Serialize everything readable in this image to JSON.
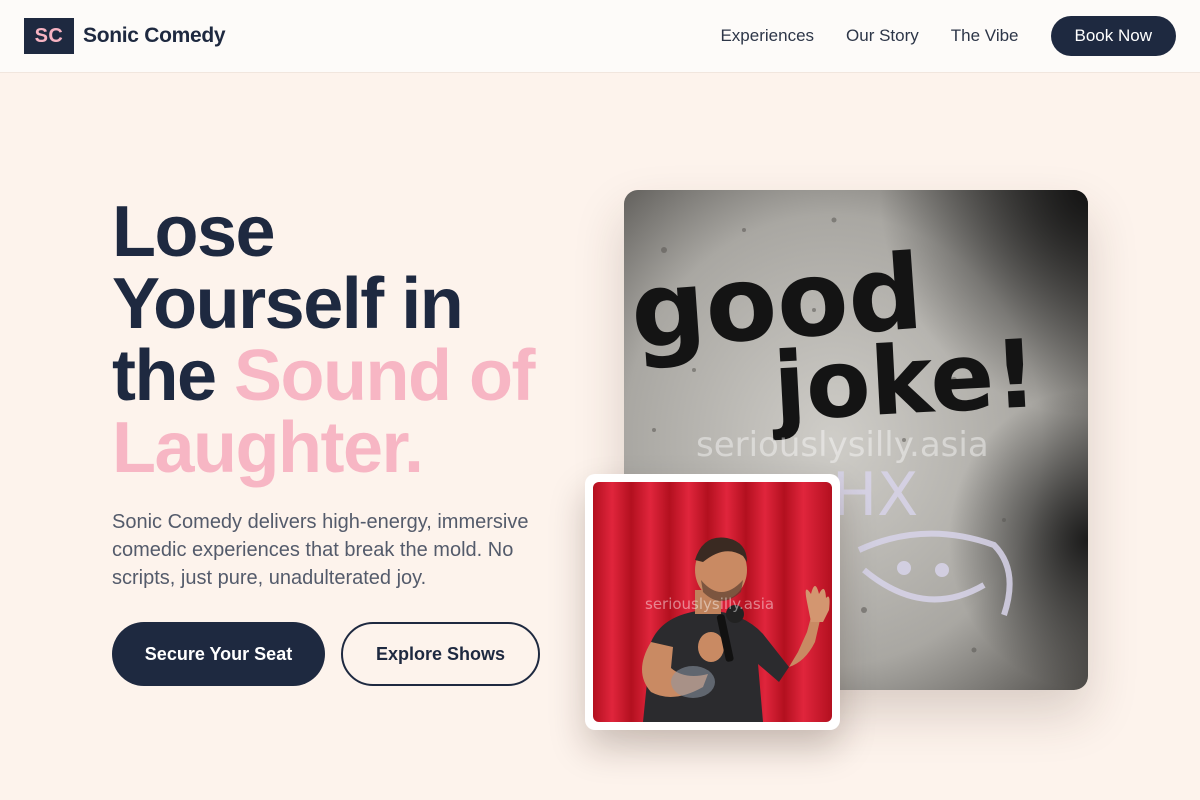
{
  "brand": {
    "logo_text": "SC",
    "name": "Sonic Comedy"
  },
  "nav": {
    "links": [
      "Experiences",
      "Our Story",
      "The Vibe"
    ],
    "cta_label": "Book Now"
  },
  "hero": {
    "title_line1": "Lose",
    "title_line2": "Yourself in",
    "title_line3_plain": "the ",
    "title_line3_accent": "Sound of",
    "title_line4_accent": "Laughter.",
    "description": "Sonic Comedy delivers high-energy, immersive comedic experiences that break the mold. No scripts, just pure, unadulterated joy.",
    "primary_cta": "Secure Your Seat",
    "secondary_cta": "Explore Shows"
  },
  "images": {
    "wall_graffiti_text_1": "good",
    "wall_graffiti_text_2": "joke!",
    "wall_graffiti_text_3": "HX",
    "watermark": "seriouslysilly.asia"
  },
  "colors": {
    "navy": "#1e2940",
    "pink_accent": "#f7b6c4",
    "background": "#fdf3ec",
    "curtain_red": "#d3182f"
  }
}
